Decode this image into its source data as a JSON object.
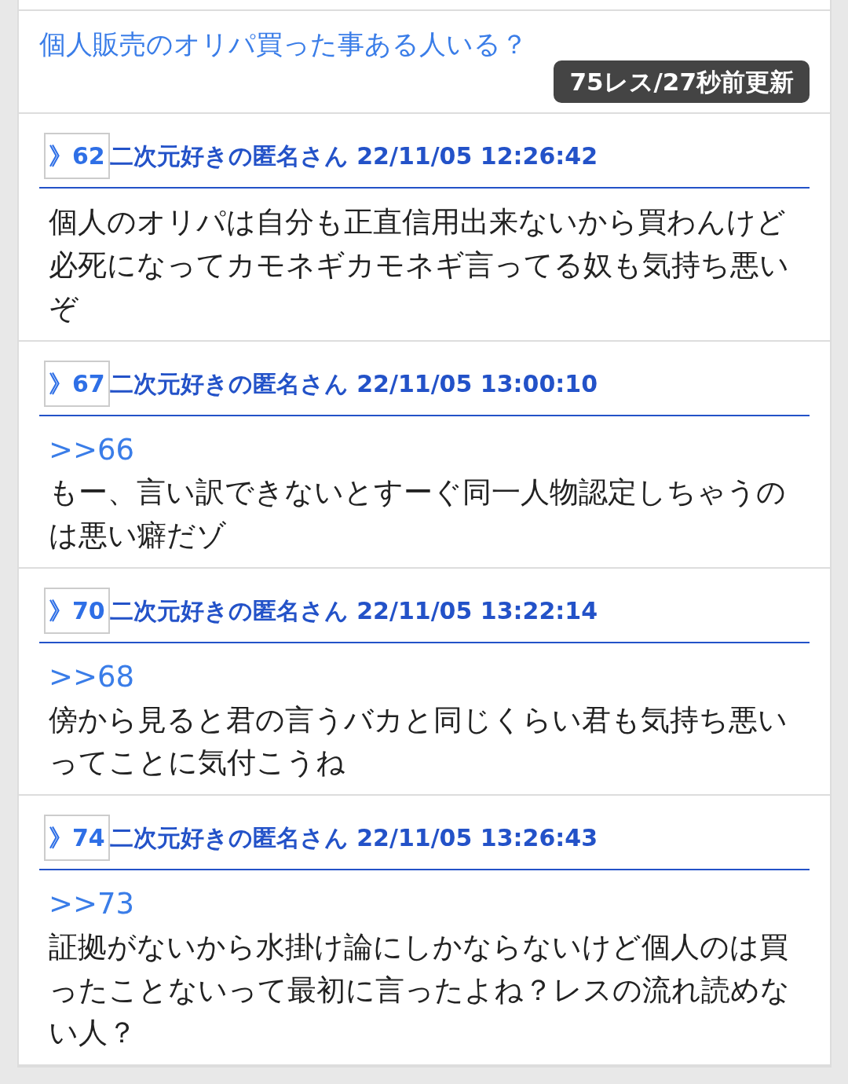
{
  "thread": {
    "title": "個人販売のオリパ買った事ある人いる？",
    "badge": "75レス/27秒前更新"
  },
  "posts": [
    {
      "number": "》62",
      "author": "二次元好きの匿名さん",
      "date": "22/11/05 12:26:42",
      "text": "個人のオリパは自分も正直信用出来ないから買わんけど必死になってカモネギカモネギ言ってる奴も気持ち悪いぞ"
    },
    {
      "number": "》67",
      "author": "二次元好きの匿名さん",
      "date": "22/11/05 13:00:10",
      "reply_to": ">>66",
      "text": "もー、言い訳できないとすーぐ同一人物認定しちゃうのは悪い癖だゾ"
    },
    {
      "number": "》70",
      "author": "二次元好きの匿名さん",
      "date": "22/11/05 13:22:14",
      "reply_to": ">>68",
      "text": "傍から見ると君の言うバカと同じくらい君も気持ち悪いってことに気付こうね"
    },
    {
      "number": "》74",
      "author": "二次元好きの匿名さん",
      "date": "22/11/05 13:26:43",
      "reply_to": ">>73",
      "text": "証拠がないから水掛け論にしかならないけど個人のは買ったことないって最初に言ったよね？レスの流れ読めない人？"
    }
  ]
}
